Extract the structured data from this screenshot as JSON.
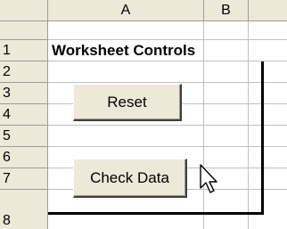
{
  "columns": [
    "A",
    "B"
  ],
  "rows": [
    "1",
    "2",
    "3",
    "4",
    "5",
    "6",
    "7",
    "8"
  ],
  "cells": {
    "a1": "Worksheet Controls"
  },
  "buttons": {
    "reset": "Reset",
    "check_data": "Check Data"
  }
}
